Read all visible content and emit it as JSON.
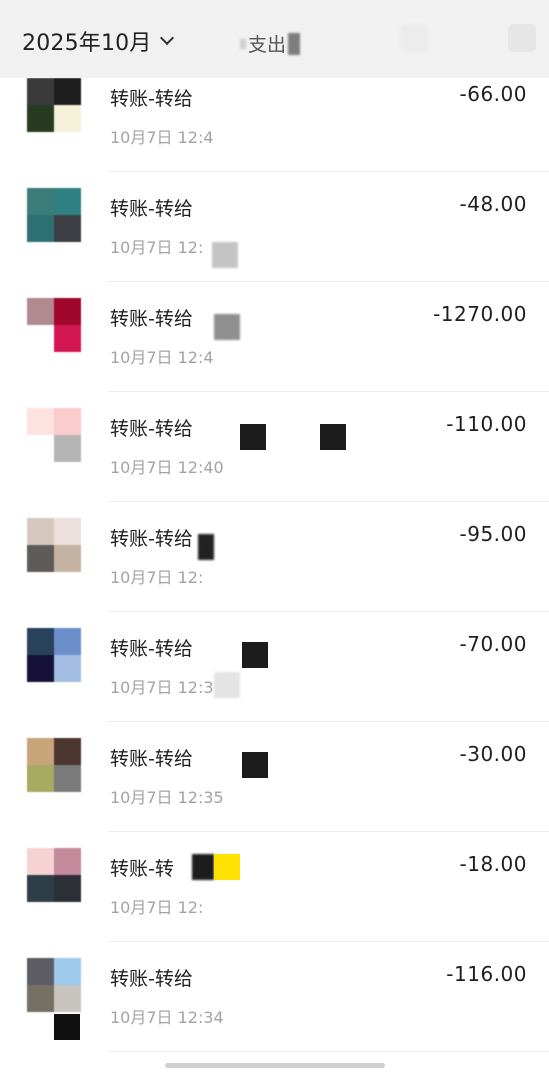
{
  "header": {
    "month_label": "2025年10月",
    "filter_label": "支出",
    "month_chevron_icon": "chevron-down-icon"
  },
  "transactions": [
    {
      "title": "转账-转给",
      "time": "10月7日 12:4",
      "amount": "-66.00",
      "avatar_colors": [
        "#3a3a3a",
        "#1e1e1e",
        "#263b1f",
        "#f5f1d8"
      ]
    },
    {
      "title": "转账-转给",
      "time": "10月7日 12:",
      "amount": "-48.00",
      "avatar_colors": [
        "#3c7c7a",
        "#2f8082",
        "#2f7074",
        "#3c3f43"
      ]
    },
    {
      "title": "转账-转给",
      "time": "10月7日 12:4",
      "amount": "-1270.00",
      "avatar_colors": [
        "#b18a90",
        "#a0072b",
        "#ffffff",
        "#d31752"
      ]
    },
    {
      "title": "转账-转给",
      "time": "10月7日 12:40",
      "amount": "-110.00",
      "avatar_colors": [
        "#fde2e2",
        "#fbcccc",
        "#ffffff",
        "#b5b5b5"
      ]
    },
    {
      "title": "转账-转给",
      "time": "10月7日 12:",
      "amount": "-95.00",
      "avatar_colors": [
        "#d6c8bd",
        "#ece0dd",
        "#5f5b58",
        "#c5b3a3"
      ]
    },
    {
      "title": "转账-转给",
      "time": "10月7日 12:3",
      "amount": "-70.00",
      "avatar_colors": [
        "#27425a",
        "#6c8fcc",
        "#151139",
        "#a4bde2"
      ]
    },
    {
      "title": "转账-转给",
      "time": "10月7日 12:35",
      "amount": "-30.00",
      "avatar_colors": [
        "#c8a47a",
        "#4b3730",
        "#a6aa62",
        "#7a7a7a"
      ]
    },
    {
      "title": "转账-转",
      "time": "10月7日 12:",
      "amount": "-18.00",
      "avatar_colors": [
        "#f5d3d3",
        "#c28a9a",
        "#2e3e48",
        "#2c2f35"
      ]
    },
    {
      "title": "转账-转给",
      "time": "10月7日 12:34",
      "amount": "-116.00",
      "avatar_colors": [
        "#5c5c64",
        "#9ecbec",
        "#767064",
        "#c8c5c1"
      ]
    }
  ]
}
